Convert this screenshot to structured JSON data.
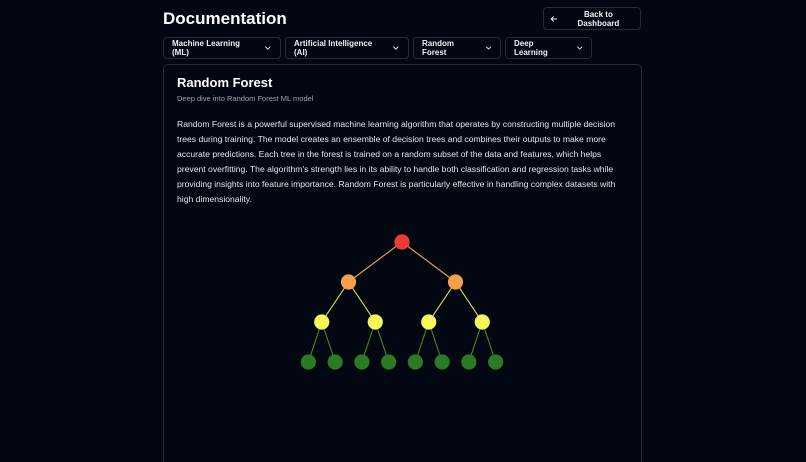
{
  "header": {
    "title": "Documentation",
    "back_label": "Back to Dashboard"
  },
  "filters": [
    {
      "label": "Machine Learning (ML)"
    },
    {
      "label": "Artificial Intelligence (AI)"
    },
    {
      "label": "Random Forest"
    },
    {
      "label": "Deep Learning"
    }
  ],
  "card": {
    "title": "Random Forest",
    "subtitle": "Deep dive into Random Forest ML model",
    "body": "Random Forest is a powerful supervised machine learning algorithm that operates by constructing multiple decision trees during training. The model creates an ensemble of decision trees and combines their outputs to make more accurate predictions. Each tree in the forest is trained on a random subset of the data and features, which helps prevent overfitting. The algorithm's strength lies in its ability to handle both classification and regression tasks while providing insights into feature importance. Random Forest is particularly effective in handling complex datasets with high dimensionality."
  },
  "tree": {
    "levels": [
      1,
      2,
      4,
      8
    ],
    "colors": {
      "root": "#ef3b36",
      "level1": "#f5a14a",
      "level2": "#f7f75a",
      "leaf": "#2b7a24",
      "edge_root": "#f5a14a",
      "edge_level1": "#e8e85a",
      "edge_leaf": "#3f8a36"
    }
  },
  "colors": {
    "background": "#030712",
    "border": "#262b36",
    "muted_text": "#9ca3af"
  }
}
